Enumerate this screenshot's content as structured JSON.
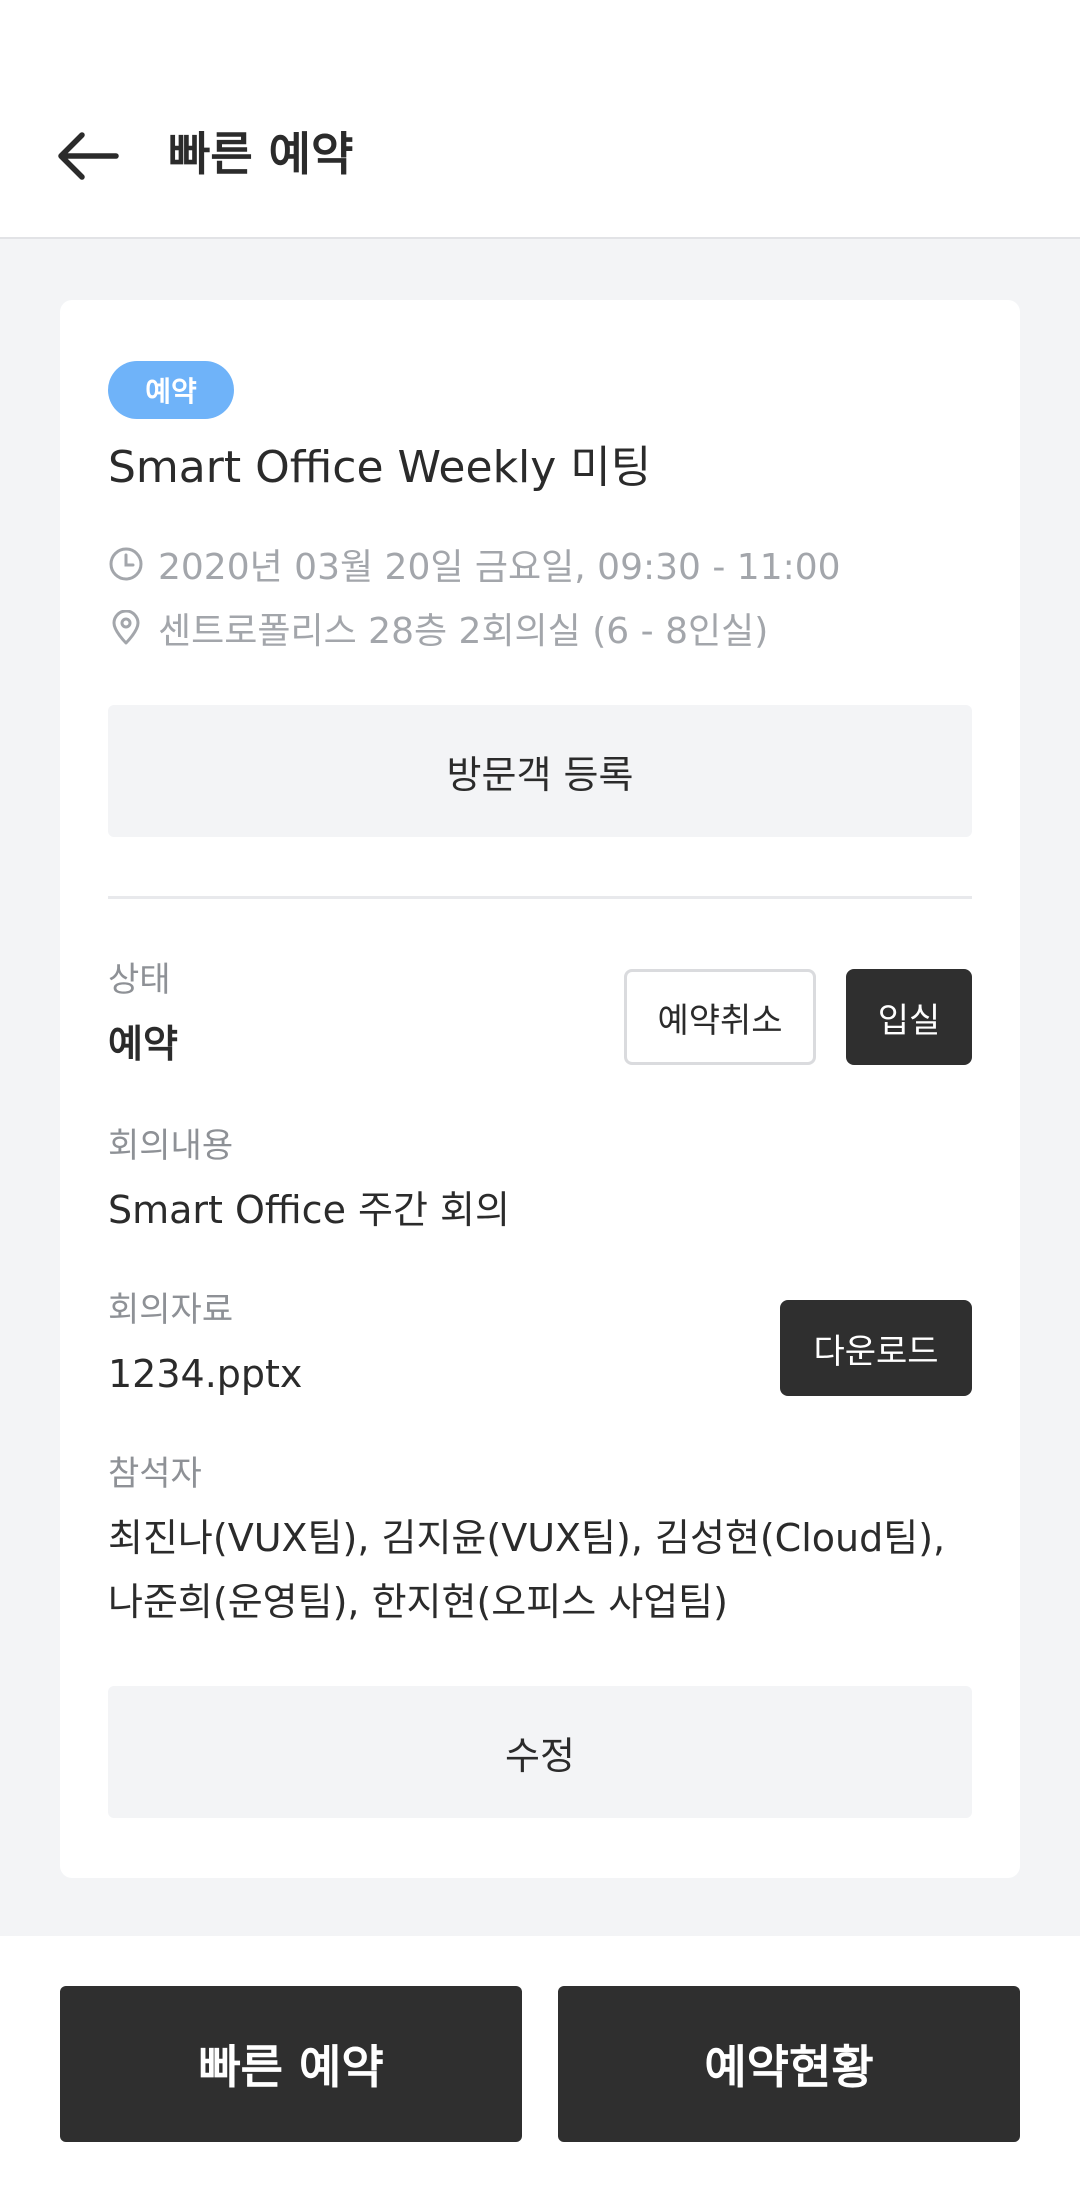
{
  "header": {
    "title": "빠른 예약",
    "back_icon": "arrow-left-icon"
  },
  "reservation": {
    "badge": "예약",
    "title": "Smart Office Weekly 미팅",
    "time": "2020년 03월 20일 금요일, 09:30 - 11:00",
    "location": "센트로폴리스 28층 2회의실 (6 - 8인실)",
    "visitor_button": "방문객 등록"
  },
  "fields": {
    "status_label": "상태",
    "status_value": "예약",
    "cancel_button": "예약취소",
    "enter_button": "입실",
    "content_label": "회의내용",
    "content_value": "Smart Office 주간 회의",
    "file_label": "회의자료",
    "file_value": "1234.pptx",
    "download_button": "다운로드",
    "attendees_label": "참석자",
    "attendees_value": "최진나(VUX팀), 김지윤(VUX팀), 김성현(Cloud팀), 나준희(운영팀), 한지현(오피스 사업팀)",
    "edit_button": "수정"
  },
  "bottom_nav": {
    "quick_reserve": "빠른 예약",
    "reservation_status": "예약현황"
  },
  "colors": {
    "badge": "#6fb3f9",
    "dark_button": "#2f2f2f",
    "background": "#f3f4f6"
  }
}
